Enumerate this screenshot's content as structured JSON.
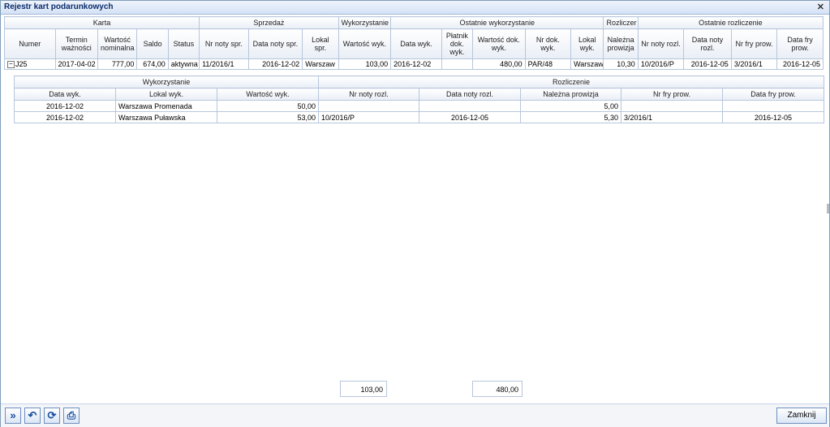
{
  "window": {
    "title": "Rejestr kart podarunkowych",
    "close_glyph": "✕"
  },
  "main": {
    "groups": [
      "Karta",
      "Sprzedaż",
      "Wykorzystanie",
      "Ostatnie wykorzystanie",
      "Rozliczer",
      "Ostatnie rozliczenie"
    ],
    "headers": [
      "Numer",
      "Termin ważności",
      "Wartość nominalna",
      "Saldo",
      "Status",
      "Nr noty spr.",
      "Data noty spr.",
      "Lokal spr.",
      "Wartość wyk.",
      "Data wyk.",
      "Płatnik dok. wyk.",
      "Wartość dok. wyk.",
      "Nr dok. wyk.",
      "Lokal wyk.",
      "Należna prowizja",
      "Nr noty rozl.",
      "Data noty rozl.",
      "Nr fry prow.",
      "Data fry prow."
    ],
    "row": [
      "J25",
      "2017-04-02",
      "777,00",
      "674,00",
      "aktywna",
      "11/2016/1",
      "2016-12-02",
      "Warszaw",
      "103,00",
      "2016-12-02",
      "",
      "480,00",
      "PAR/48",
      "Warszaw",
      "10,30",
      "10/2016/P",
      "2016-12-05",
      "3/2016/1",
      "2016-12-05"
    ],
    "expander": "−"
  },
  "detail": {
    "groups": [
      "Wykorzystanie",
      "Rozliczenie"
    ],
    "headers": [
      "Data wyk.",
      "Lokal wyk.",
      "Wartość wyk.",
      "Nr noty rozl.",
      "Data noty rozl.",
      "Należna prowizja",
      "Nr fry prow.",
      "Data fry prow."
    ],
    "rows": [
      [
        "2016-12-02",
        "Warszawa Promenada",
        "50,00",
        "",
        "",
        "5,00",
        "",
        ""
      ],
      [
        "2016-12-02",
        "Warszawa Puławska",
        "53,00",
        "10/2016/P",
        "2016-12-05",
        "5,30",
        "3/2016/1",
        "2016-12-05"
      ]
    ]
  },
  "totals": {
    "wartosc_wyk": "103,00",
    "wartosc_dok": "480,00"
  },
  "toolbar": {
    "buttons": [
      {
        "name": "expand-icon",
        "glyph": "»"
      },
      {
        "name": "undo-icon",
        "glyph": "↶"
      },
      {
        "name": "refresh-icon",
        "glyph": "⟳"
      },
      {
        "name": "print-icon",
        "glyph": "⎙"
      }
    ],
    "close_label": "Zamknij"
  }
}
